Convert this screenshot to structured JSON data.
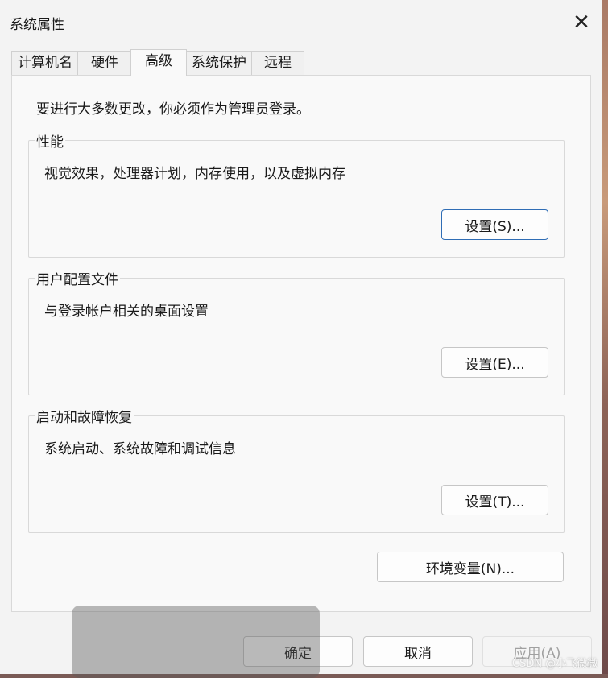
{
  "window": {
    "title": "系统属性"
  },
  "icons": {
    "close": "close-icon"
  },
  "tabs": [
    {
      "label": "计算机名"
    },
    {
      "label": "硬件"
    },
    {
      "label": "高级"
    },
    {
      "label": "系统保护"
    },
    {
      "label": "远程"
    }
  ],
  "active_tab": "高级",
  "advanced": {
    "notice": "要进行大多数更改，你必须作为管理员登录。",
    "performance": {
      "label": "性能",
      "desc": "视觉效果，处理器计划，内存使用，以及虚拟内存",
      "button": "设置(S)..."
    },
    "user_profiles": {
      "label": "用户配置文件",
      "desc": "与登录帐户相关的桌面设置",
      "button": "设置(E)..."
    },
    "startup_recovery": {
      "label": "启动和故障恢复",
      "desc": "系统启动、系统故障和调试信息",
      "button": "设置(T)..."
    },
    "env_button": "环境变量(N)..."
  },
  "footer": {
    "ok": "确定",
    "cancel": "取消",
    "apply": "应用(A)"
  },
  "watermark": "CSDN @小飞微微",
  "colors": {
    "focus_border": "#2f6db5",
    "window_bg": "#f3f3f3",
    "panel_bg": "#f9f9f9"
  }
}
